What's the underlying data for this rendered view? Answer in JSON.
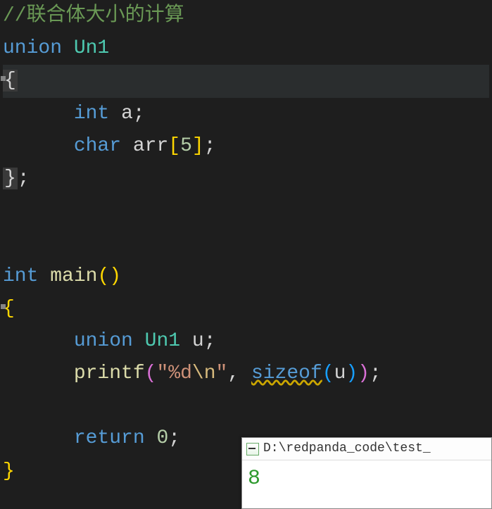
{
  "code": {
    "l1_comment": "//联合体大小的计算",
    "l2_union": "union",
    "l2_name": "Un1",
    "l3_brace": "{",
    "l4_type": "int",
    "l4_var": "a",
    "l5_type": "char",
    "l5_var": "arr",
    "l5_open": "[",
    "l5_num": "5",
    "l5_close": "]",
    "l6_brace": "}",
    "l8_type": "int",
    "l8_func": "main",
    "l9_brace": "{",
    "l10_union": "union",
    "l10_name": "Un1",
    "l10_var": "u",
    "l11_func": "printf",
    "l11_str1": "\"%d",
    "l11_esc": "\\n",
    "l11_str2": "\"",
    "l11_comma": ",",
    "l11_sizeof": "sizeof",
    "l11_arg": "u",
    "l12_return": "return",
    "l12_num": "0",
    "l13_brace": "}"
  },
  "output": {
    "title": "D:\\redpanda_code\\test_",
    "value": "8"
  }
}
